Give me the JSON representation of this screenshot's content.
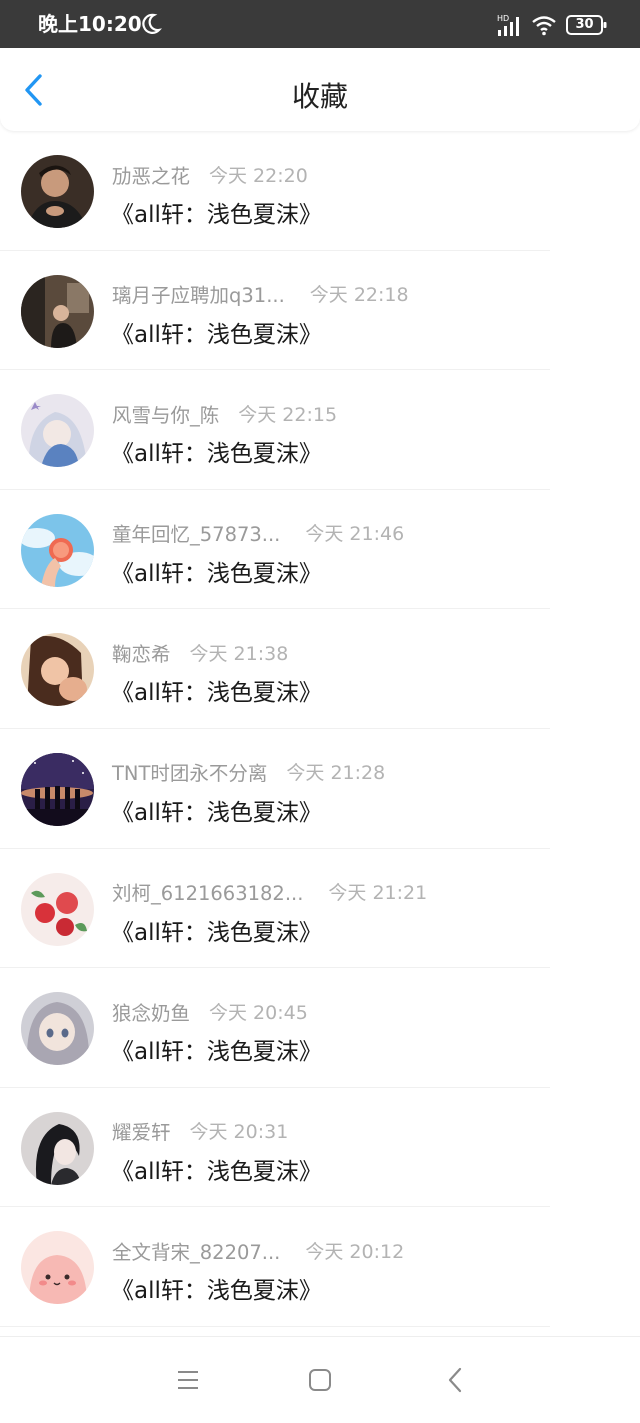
{
  "status_bar": {
    "time": "晚上10:20",
    "battery": "30",
    "network_label": "HD",
    "icons": [
      "moon-icon",
      "signal-icon",
      "wifi-icon",
      "battery-icon"
    ]
  },
  "header": {
    "title": "收藏",
    "back_icon": "chevron-left-icon",
    "accent_color": "#2196f3"
  },
  "favorites": [
    {
      "name": "劢恶之花",
      "time": "今天 22:20",
      "book": "《all轩：浅色夏沫》"
    },
    {
      "name": "璃月子应聘加q31...",
      "time": "今天 22:18",
      "book": "《all轩：浅色夏沫》"
    },
    {
      "name": "风雪与你_陈",
      "time": "今天 22:15",
      "book": "《all轩：浅色夏沫》"
    },
    {
      "name": "童年回忆_57873...",
      "time": "今天 21:46",
      "book": "《all轩：浅色夏沫》"
    },
    {
      "name": "鞠恋希",
      "time": "今天 21:38",
      "book": "《all轩：浅色夏沫》"
    },
    {
      "name": "TNT时团永不分离",
      "time": "今天 21:28",
      "book": "《all轩：浅色夏沫》"
    },
    {
      "name": "刘柯_6121663182...",
      "time": "今天 21:21",
      "book": "《all轩：浅色夏沫》"
    },
    {
      "name": "狼念奶鱼",
      "time": "今天 20:45",
      "book": "《all轩：浅色夏沫》"
    },
    {
      "name": "耀爱轩",
      "time": "今天 20:31",
      "book": "《all轩：浅色夏沫》"
    },
    {
      "name": "全文背宋_82207...",
      "time": "今天 20:12",
      "book": "《all轩：浅色夏沫》"
    }
  ],
  "nav_bar": {
    "icons": [
      "menu-icon",
      "home-icon",
      "back-icon"
    ]
  }
}
